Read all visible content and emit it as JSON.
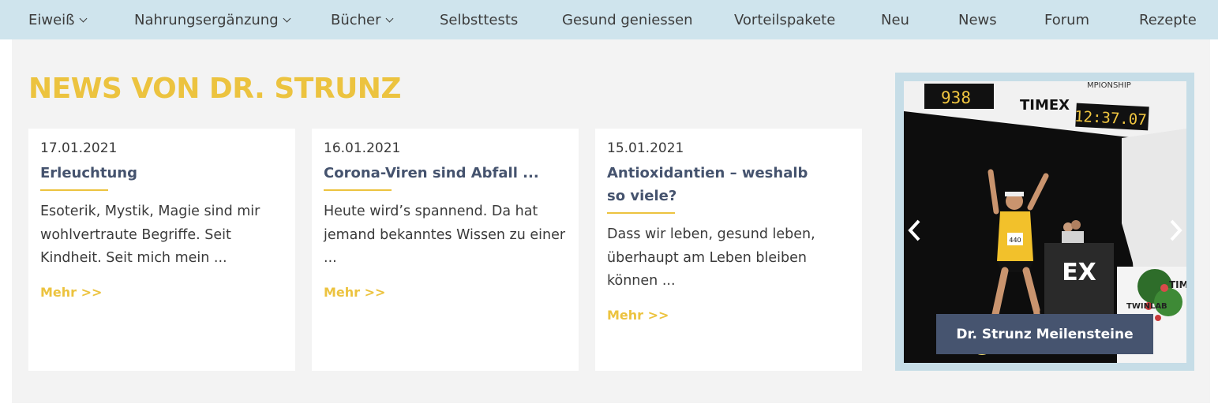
{
  "nav": {
    "items": [
      {
        "label": "Eiweiß",
        "dropdown": true
      },
      {
        "label": "Nahrungsergänzung",
        "dropdown": true
      },
      {
        "label": "Bücher",
        "dropdown": true
      },
      {
        "label": "Selbsttests",
        "dropdown": false
      },
      {
        "label": "Gesund geniessen",
        "dropdown": false
      },
      {
        "label": "Vorteilspakete",
        "dropdown": false
      },
      {
        "label": "Neu",
        "dropdown": false
      },
      {
        "label": "News",
        "dropdown": false
      },
      {
        "label": "Forum",
        "dropdown": false
      },
      {
        "label": "Rezepte",
        "dropdown": false
      }
    ]
  },
  "section": {
    "title": "NEWS VON DR. STRUNZ"
  },
  "news": [
    {
      "date": "17.01.2021",
      "title": "Erleuchtung",
      "excerpt": "Esoterik, Mystik, Magie sind mir wohlvertraute Begriffe. Seit Kindheit. Seit mich mein ...",
      "more": "Mehr >>"
    },
    {
      "date": "16.01.2021",
      "title": "Corona-Viren sind Abfall ...",
      "excerpt": "Heute wird’s spannend. Da hat jemand bekanntes Wissen zu einer ...",
      "more": "Mehr >>"
    },
    {
      "date": "15.01.2021",
      "title": "Antioxidantien – weshalb so viele?",
      "excerpt": "Dass wir leben, gesund leben, überhaupt am Leben bleiben können ...",
      "more": "Mehr >>"
    }
  ],
  "slider": {
    "caption": "Dr. Strunz Meilensteine",
    "photo_text": {
      "brand": "TIMEX",
      "clock_left": "938",
      "clock_right": "12:37.07",
      "banner": "MPIONSHIP",
      "bib": "440",
      "sponsor": "TWINLAB",
      "sign": "EX",
      "side_brand": "TIM"
    },
    "prev_icon": "chevron-left-icon",
    "next_icon": "chevron-right-icon"
  },
  "colors": {
    "nav_bg": "#cfe4ed",
    "accent": "#ecc33f",
    "title_blue": "#45536e",
    "panel_bg": "#f3f3f3"
  }
}
